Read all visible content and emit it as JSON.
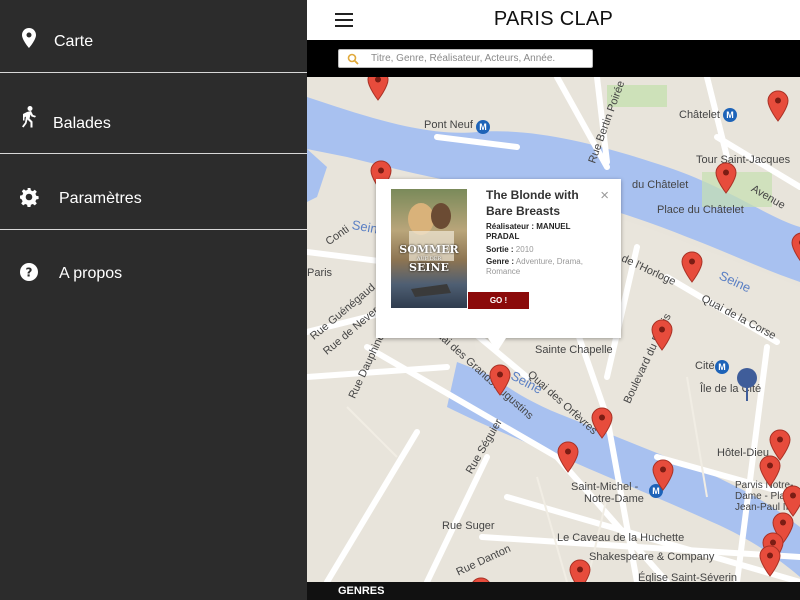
{
  "sidebar": {
    "items": [
      {
        "label": "Carte",
        "icon": "map-pin-icon"
      },
      {
        "label": "Balades",
        "icon": "walker-icon"
      },
      {
        "label": "Paramètres",
        "icon": "gear-icon"
      },
      {
        "label": "A propos",
        "icon": "help-circle-icon"
      }
    ]
  },
  "header": {
    "title": "PARIS CLAP",
    "menu_icon": "hamburger-menu-icon"
  },
  "search": {
    "placeholder": "Titre, Genre, Réalisateur, Acteurs, Année.",
    "value": ""
  },
  "map": {
    "labels": {
      "pont_neuf": "Pont Neuf",
      "chatelet": "Châtelet",
      "tour_saint_jacques": "Tour Saint-Jacques",
      "du_chatelet": "du Châtelet",
      "place_du_chatelet": "Place du Châtelet",
      "avenue": "Avenue",
      "seine_1": "Seine",
      "seine_2": "Seine",
      "seine_3": "Seine",
      "quai_de_l_horloge": "de l'Horloge",
      "quai_de_la_corse": "Quai de la Corse",
      "sainte_chapelle": "Sainte Chapelle",
      "cite": "Cité",
      "ile_de_la_cite": "Île de la Cité",
      "rue_bertin_poiree": "Rue Bertin Poirée",
      "conti": "Conti",
      "paris": "Paris",
      "rue_guenegaud": "Rue Guénégaud",
      "rue_de_nevers": "Rue de Nevers",
      "rue_dauphine": "Rue Dauphine",
      "quai_des_grands_augustins": "Quai des Grands Augustins",
      "rue_seguier": "Rue Séguier",
      "quai_des_orfevres": "Quai des Orfèvres",
      "boulevard_du_palais": "Boulevard du Palais",
      "hotel_dieu": "Hôtel-Dieu",
      "parvis": "Parvis Notre-Dame - Place Jean-Paul II",
      "saint_michel": "Saint-Michel -",
      "notre_dame": "Notre-Dame",
      "rue_suger": "Rue Suger",
      "rue_danton": "Rue Danton",
      "caveau": "Le Caveau de la Huchette",
      "shakespeare": "Shakespeare & Company",
      "eglise": "Église Saint-Séverin"
    },
    "metro_glyph": "M"
  },
  "popup": {
    "title": "The Blonde with Bare Breasts",
    "close": "×",
    "poster_title": "SOMMER",
    "poster_sub": "AUF DER",
    "poster_title2": "SEINE",
    "director_label": "Réalisateur :",
    "director_value": "MANUEL PRADAL",
    "release_label": "Sortie :",
    "release_value": "2010",
    "genre_label": "Genre :",
    "genre_value": "Adventure, Drama, Romance",
    "go_label": "GO !"
  },
  "footer": {
    "genres_label": "GENRES"
  },
  "colors": {
    "sidebar_bg": "#2c2c2c",
    "pin_red": "#e74c3c",
    "go_button": "#8b0a0a",
    "water": "#a8c1f0",
    "location_dot": "#3f5d9a"
  }
}
